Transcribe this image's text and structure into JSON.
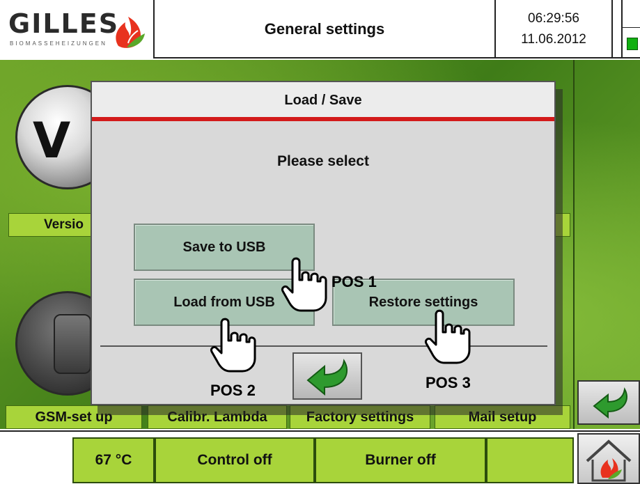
{
  "header": {
    "logo_text": "GILLES",
    "logo_subtitle": "BIOMASSEHEIZUNGEN",
    "title": "General settings",
    "time": "06:29:56",
    "date": "11.06.2012"
  },
  "background": {
    "version_button_glyph": "V",
    "version_label": "Versio",
    "bottom_tabs": [
      "GSM-set up",
      "Calibr. Lambda",
      "Factory settings",
      "Mail setup"
    ]
  },
  "dialog": {
    "title": "Load / Save",
    "prompt": "Please select",
    "buttons": {
      "save": "Save to USB",
      "load": "Load from USB",
      "restore": "Restore settings"
    },
    "back_icon": "back-arrow-icon"
  },
  "status_bar": {
    "temperature": "67 °C",
    "control": "Control off",
    "burner": "Burner off",
    "empty": ""
  },
  "annotations": {
    "pos1": "POS 1",
    "pos2": "POS 2",
    "pos3": "POS 3"
  },
  "colors": {
    "accent_green": "#a8d43a",
    "dialog_red_line": "#d31a1a",
    "dialog_button": "#a9c5b4",
    "arrow_green": "#2e9a2e",
    "led_green": "#12b012"
  }
}
